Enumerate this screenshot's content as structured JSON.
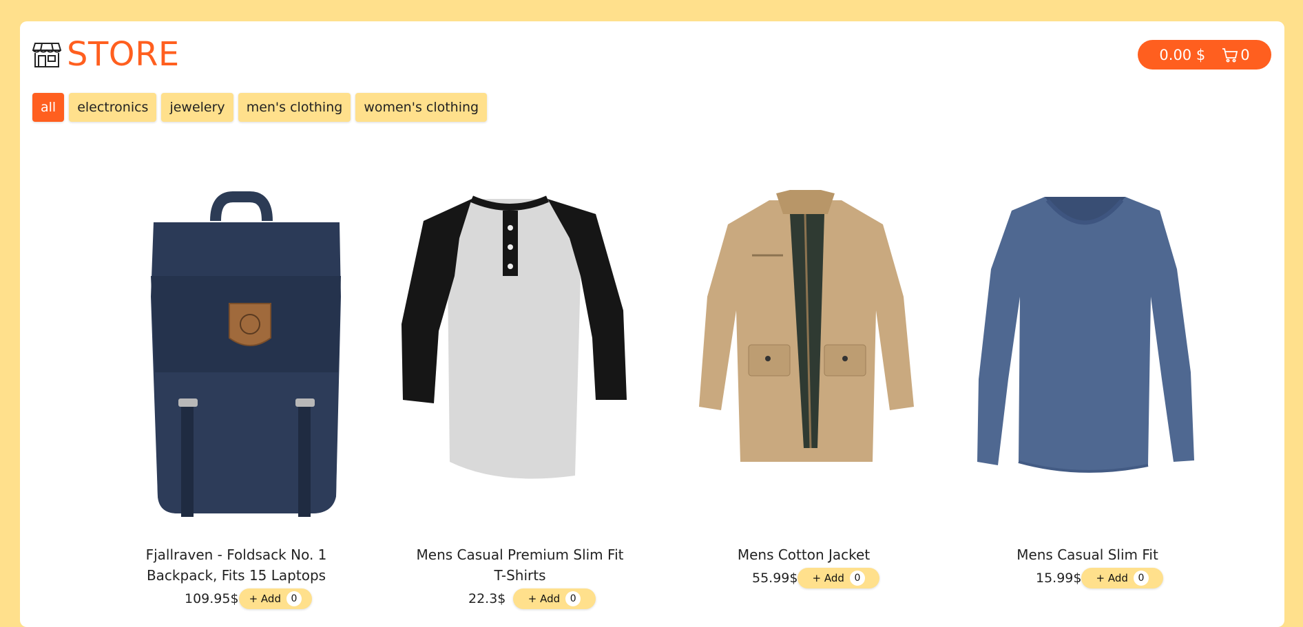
{
  "brand": {
    "name": "STORE",
    "icon": "storefront-icon",
    "accent": "#ff5f1f",
    "secondary": "#ffe08c"
  },
  "cart": {
    "total": "0.00 $",
    "count": "0",
    "icon": "cart-icon"
  },
  "filters": [
    "all",
    "electronics",
    "jewelery",
    "men's clothing",
    "women's clothing"
  ],
  "active_filter": "all",
  "products": [
    {
      "title": "Fjallraven - Foldsack No. 1 Backpack, Fits 15 Laptops",
      "price": "109.95$",
      "add_label": "+ Add",
      "qty": "0"
    },
    {
      "title": "Mens Casual Premium Slim Fit T-Shirts",
      "price": "22.3$",
      "add_label": "+ Add",
      "qty": "0"
    },
    {
      "title": "Mens Cotton Jacket",
      "price": "55.99$",
      "add_label": "+ Add",
      "qty": "0"
    },
    {
      "title": "Mens Casual Slim Fit",
      "price": "15.99$",
      "add_label": "+ Add",
      "qty": "0"
    }
  ]
}
